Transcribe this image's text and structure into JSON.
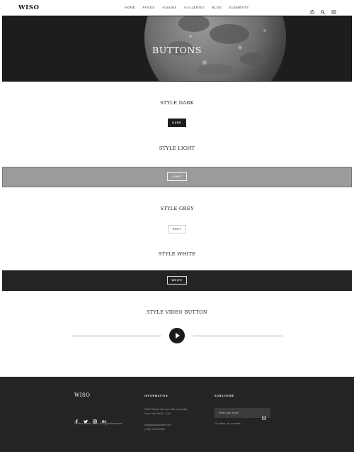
{
  "header": {
    "logo": "WISO",
    "nav": [
      "HOME",
      "PAGES",
      "ALBUMS",
      "GALLERIES",
      "BLOG",
      "ELEMENTS"
    ],
    "icons": [
      "cart-icon",
      "search-icon",
      "menu-icon"
    ]
  },
  "hero": {
    "title": "BUTTONS"
  },
  "sections": {
    "dark": {
      "title": "STYLE DARK",
      "button": "DARK"
    },
    "light": {
      "title": "STYLE LIGHT",
      "button": "LIGHT"
    },
    "grey": {
      "title": "STYLE GREY",
      "button": "GREY"
    },
    "white": {
      "title": "STYLE WHITE",
      "button": "WHITE"
    },
    "video": {
      "title": "STYLE VIDEO BUTTON"
    }
  },
  "footer": {
    "logo": "WISO",
    "social_icons": [
      "facebook-icon",
      "twitter-icon",
      "instagram-icon",
      "behance-icon"
    ],
    "copyright": "© Wiso Studio 2018. All Right Reserved",
    "information": {
      "heading": "INFORMATION",
      "address_line1": "2005 Stokes Isle Apt. 896, Venaville,",
      "address_line2": "New York 10010, USA",
      "email": "info@yourdomain.com",
      "phone": "(+68) 120034509"
    },
    "subscribe": {
      "heading": "SUBSCRIBE",
      "placeholder": "Enter your email",
      "note": "No spam, we promise."
    }
  },
  "colors": {
    "dark": "#242424",
    "grey_band": "#9b9b9b",
    "white": "#ffffff"
  }
}
